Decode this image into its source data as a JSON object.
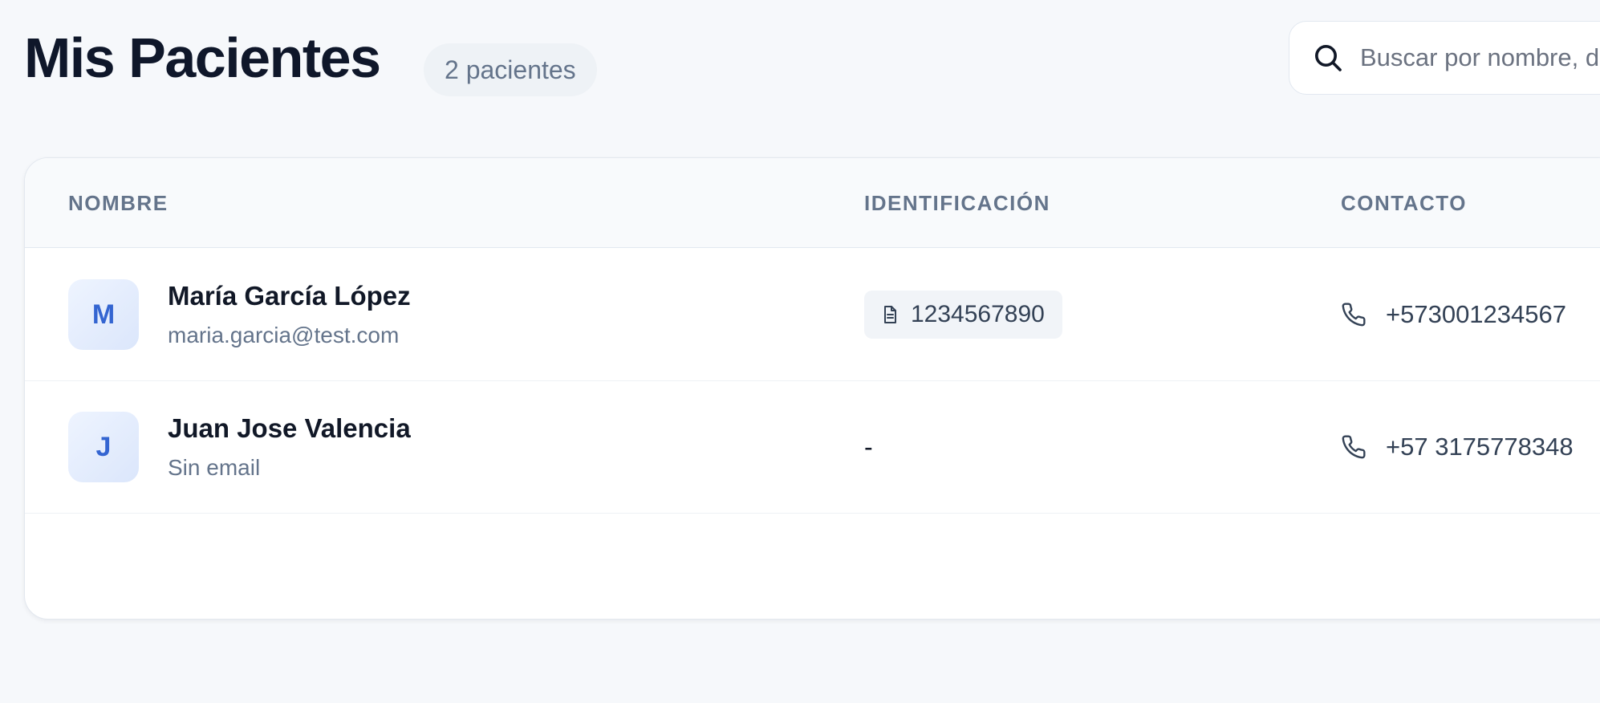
{
  "header": {
    "title": "Mis Pacientes",
    "count_badge": "2 pacientes"
  },
  "search": {
    "placeholder": "Buscar por nombre, d",
    "icon": "search-icon"
  },
  "table": {
    "columns": [
      "NOMBRE",
      "IDENTIFICACIÓN",
      "CONTACTO"
    ],
    "rows": [
      {
        "initial": "M",
        "name": "María García López",
        "email": "maria.garcia@test.com",
        "identification": "1234567890",
        "phone": "+573001234567"
      },
      {
        "initial": "J",
        "name": "Juan Jose Valencia",
        "email": "Sin email",
        "identification": "-",
        "phone": "+57 3175778348"
      }
    ]
  },
  "colors": {
    "title": "#0f172a",
    "muted": "#64748b",
    "accent": "#3465d1",
    "background": "#f6f8fb"
  }
}
